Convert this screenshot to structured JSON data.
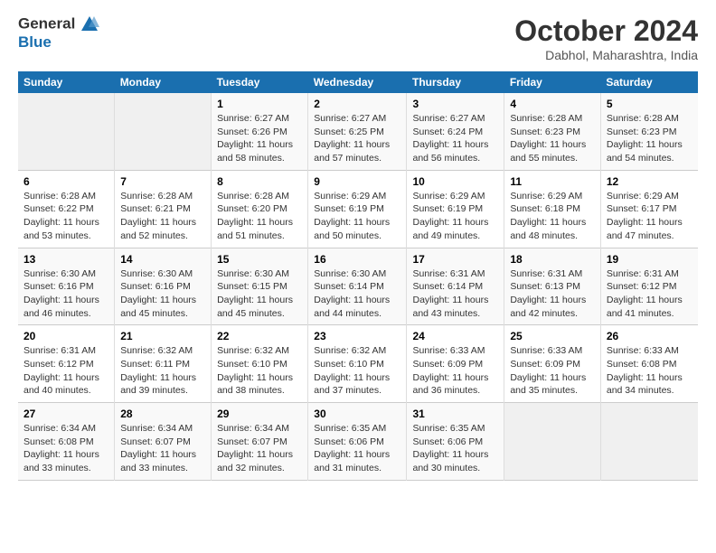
{
  "logo": {
    "line1": "General",
    "line2": "Blue"
  },
  "title": "October 2024",
  "subtitle": "Dabhol, Maharashtra, India",
  "headers": [
    "Sunday",
    "Monday",
    "Tuesday",
    "Wednesday",
    "Thursday",
    "Friday",
    "Saturday"
  ],
  "weeks": [
    [
      {
        "day": "",
        "info": ""
      },
      {
        "day": "",
        "info": ""
      },
      {
        "day": "1",
        "info": "Sunrise: 6:27 AM\nSunset: 6:26 PM\nDaylight: 11 hours and 58 minutes."
      },
      {
        "day": "2",
        "info": "Sunrise: 6:27 AM\nSunset: 6:25 PM\nDaylight: 11 hours and 57 minutes."
      },
      {
        "day": "3",
        "info": "Sunrise: 6:27 AM\nSunset: 6:24 PM\nDaylight: 11 hours and 56 minutes."
      },
      {
        "day": "4",
        "info": "Sunrise: 6:28 AM\nSunset: 6:23 PM\nDaylight: 11 hours and 55 minutes."
      },
      {
        "day": "5",
        "info": "Sunrise: 6:28 AM\nSunset: 6:23 PM\nDaylight: 11 hours and 54 minutes."
      }
    ],
    [
      {
        "day": "6",
        "info": "Sunrise: 6:28 AM\nSunset: 6:22 PM\nDaylight: 11 hours and 53 minutes."
      },
      {
        "day": "7",
        "info": "Sunrise: 6:28 AM\nSunset: 6:21 PM\nDaylight: 11 hours and 52 minutes."
      },
      {
        "day": "8",
        "info": "Sunrise: 6:28 AM\nSunset: 6:20 PM\nDaylight: 11 hours and 51 minutes."
      },
      {
        "day": "9",
        "info": "Sunrise: 6:29 AM\nSunset: 6:19 PM\nDaylight: 11 hours and 50 minutes."
      },
      {
        "day": "10",
        "info": "Sunrise: 6:29 AM\nSunset: 6:19 PM\nDaylight: 11 hours and 49 minutes."
      },
      {
        "day": "11",
        "info": "Sunrise: 6:29 AM\nSunset: 6:18 PM\nDaylight: 11 hours and 48 minutes."
      },
      {
        "day": "12",
        "info": "Sunrise: 6:29 AM\nSunset: 6:17 PM\nDaylight: 11 hours and 47 minutes."
      }
    ],
    [
      {
        "day": "13",
        "info": "Sunrise: 6:30 AM\nSunset: 6:16 PM\nDaylight: 11 hours and 46 minutes."
      },
      {
        "day": "14",
        "info": "Sunrise: 6:30 AM\nSunset: 6:16 PM\nDaylight: 11 hours and 45 minutes."
      },
      {
        "day": "15",
        "info": "Sunrise: 6:30 AM\nSunset: 6:15 PM\nDaylight: 11 hours and 45 minutes."
      },
      {
        "day": "16",
        "info": "Sunrise: 6:30 AM\nSunset: 6:14 PM\nDaylight: 11 hours and 44 minutes."
      },
      {
        "day": "17",
        "info": "Sunrise: 6:31 AM\nSunset: 6:14 PM\nDaylight: 11 hours and 43 minutes."
      },
      {
        "day": "18",
        "info": "Sunrise: 6:31 AM\nSunset: 6:13 PM\nDaylight: 11 hours and 42 minutes."
      },
      {
        "day": "19",
        "info": "Sunrise: 6:31 AM\nSunset: 6:12 PM\nDaylight: 11 hours and 41 minutes."
      }
    ],
    [
      {
        "day": "20",
        "info": "Sunrise: 6:31 AM\nSunset: 6:12 PM\nDaylight: 11 hours and 40 minutes."
      },
      {
        "day": "21",
        "info": "Sunrise: 6:32 AM\nSunset: 6:11 PM\nDaylight: 11 hours and 39 minutes."
      },
      {
        "day": "22",
        "info": "Sunrise: 6:32 AM\nSunset: 6:10 PM\nDaylight: 11 hours and 38 minutes."
      },
      {
        "day": "23",
        "info": "Sunrise: 6:32 AM\nSunset: 6:10 PM\nDaylight: 11 hours and 37 minutes."
      },
      {
        "day": "24",
        "info": "Sunrise: 6:33 AM\nSunset: 6:09 PM\nDaylight: 11 hours and 36 minutes."
      },
      {
        "day": "25",
        "info": "Sunrise: 6:33 AM\nSunset: 6:09 PM\nDaylight: 11 hours and 35 minutes."
      },
      {
        "day": "26",
        "info": "Sunrise: 6:33 AM\nSunset: 6:08 PM\nDaylight: 11 hours and 34 minutes."
      }
    ],
    [
      {
        "day": "27",
        "info": "Sunrise: 6:34 AM\nSunset: 6:08 PM\nDaylight: 11 hours and 33 minutes."
      },
      {
        "day": "28",
        "info": "Sunrise: 6:34 AM\nSunset: 6:07 PM\nDaylight: 11 hours and 33 minutes."
      },
      {
        "day": "29",
        "info": "Sunrise: 6:34 AM\nSunset: 6:07 PM\nDaylight: 11 hours and 32 minutes."
      },
      {
        "day": "30",
        "info": "Sunrise: 6:35 AM\nSunset: 6:06 PM\nDaylight: 11 hours and 31 minutes."
      },
      {
        "day": "31",
        "info": "Sunrise: 6:35 AM\nSunset: 6:06 PM\nDaylight: 11 hours and 30 minutes."
      },
      {
        "day": "",
        "info": ""
      },
      {
        "day": "",
        "info": ""
      }
    ]
  ]
}
